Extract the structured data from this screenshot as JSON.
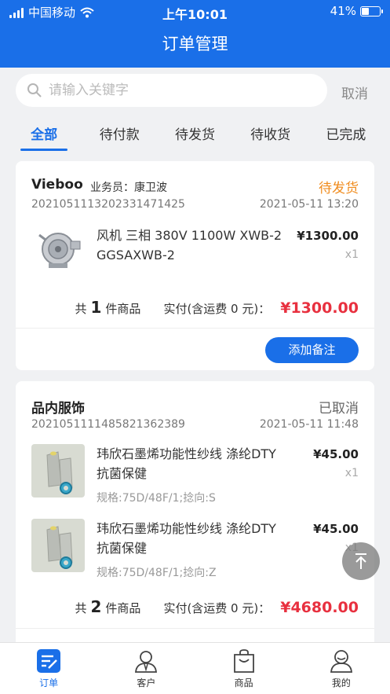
{
  "status_bar": {
    "carrier": "中国移动",
    "time": "上午10:01",
    "battery": "41%",
    "battery_level": 0.41
  },
  "nav": {
    "title": "订单管理"
  },
  "search": {
    "placeholder": "请输入关键字",
    "value": "",
    "cancel": "取消"
  },
  "tabs": [
    {
      "label": "全部",
      "active": true
    },
    {
      "label": "待付款"
    },
    {
      "label": "待发货"
    },
    {
      "label": "待收货"
    },
    {
      "label": "已完成"
    }
  ],
  "orders": [
    {
      "shop": "Vieboo",
      "clerk": "业务员：康卫波",
      "status": "待发货",
      "status_color": "#f08c1e",
      "order_no": "2021051113202331471425",
      "date": "2021-05-11 13:20",
      "items": [
        {
          "name_line1": "风机 三相 380V 1100W XWB-2",
          "name_line2": "GGSAXWB-2",
          "price": "¥1300.00",
          "qty": "x1",
          "image": "blower-fan-image"
        }
      ],
      "summary": {
        "prefix": "共",
        "count": "1",
        "suffix": "件商品",
        "paid_label": "实付(含运费 0 元)：",
        "total": "¥1300.00"
      },
      "action": "添加备注"
    },
    {
      "shop": "品内服饰",
      "status": "已取消",
      "status_color": "#666666",
      "order_no": "2021051111485821362389",
      "date": "2021-05-11 11:48",
      "items": [
        {
          "name_line1": "玮欣石墨烯功能性纱线 涤纶DTY",
          "name_line2": "抗菌保健",
          "spec": "规格:75D/48F/1;捻向:S",
          "price": "¥45.00",
          "qty": "x1",
          "image": "yarn-spool-image"
        },
        {
          "name_line1": "玮欣石墨烯功能性纱线 涤纶DTY",
          "name_line2": "抗菌保健",
          "spec": "规格:75D/48F/1;捻向:Z",
          "price": "¥45.00",
          "qty": "x1",
          "image": "yarn-spool-image"
        }
      ],
      "summary": {
        "prefix": "共",
        "count": "2",
        "suffix": "件商品",
        "paid_label": "实付(含运费 0 元)：",
        "total": "¥4680.00"
      }
    }
  ],
  "bottom_tabs": [
    {
      "label": "订单",
      "icon": "order-icon",
      "active": true
    },
    {
      "label": "客户",
      "icon": "customer-icon"
    },
    {
      "label": "商品",
      "icon": "product-bag-icon"
    },
    {
      "label": "我的",
      "icon": "profile-icon"
    }
  ],
  "colors": {
    "primary": "#1a6fe8",
    "price_red": "#e8303f",
    "pending_orange": "#f08c1e"
  }
}
